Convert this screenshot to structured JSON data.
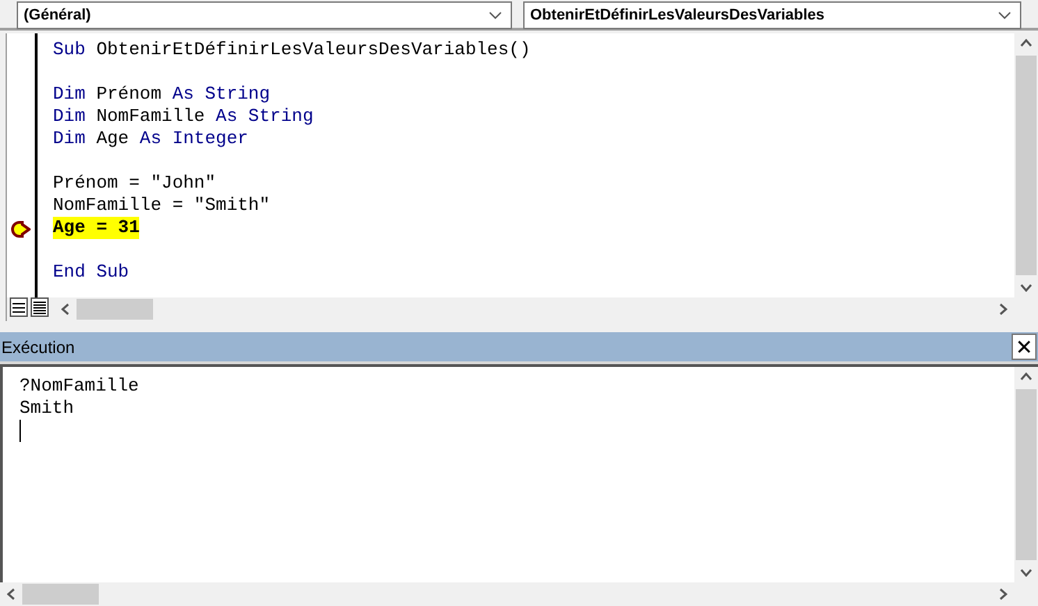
{
  "object_box": {
    "value": "(Général)"
  },
  "procedure_box": {
    "value": "ObtenirEtDéfinirLesValeursDesVariables"
  },
  "code_lines": [
    {
      "gap_before": false,
      "current": false,
      "tokens": [
        {
          "text": "Sub",
          "kind": "keyword"
        },
        {
          "text": " ObtenirEtDéfinirLesValeursDesVariables()",
          "kind": "plain"
        }
      ]
    },
    {
      "gap_before": true,
      "current": false,
      "tokens": [
        {
          "text": "Dim",
          "kind": "keyword"
        },
        {
          "text": " Prénom ",
          "kind": "plain"
        },
        {
          "text": "As String",
          "kind": "keyword"
        }
      ]
    },
    {
      "gap_before": false,
      "current": false,
      "tokens": [
        {
          "text": "Dim",
          "kind": "keyword"
        },
        {
          "text": " NomFamille ",
          "kind": "plain"
        },
        {
          "text": "As String",
          "kind": "keyword"
        }
      ]
    },
    {
      "gap_before": false,
      "current": false,
      "tokens": [
        {
          "text": "Dim",
          "kind": "keyword"
        },
        {
          "text": " Age ",
          "kind": "plain"
        },
        {
          "text": "As Integer",
          "kind": "keyword"
        }
      ]
    },
    {
      "gap_before": true,
      "current": false,
      "tokens": [
        {
          "text": "Prénom = \"John\"",
          "kind": "plain"
        }
      ]
    },
    {
      "gap_before": false,
      "current": false,
      "tokens": [
        {
          "text": "NomFamille = \"Smith\"",
          "kind": "plain"
        }
      ]
    },
    {
      "gap_before": false,
      "current": true,
      "tokens": [
        {
          "text": "Age = 31",
          "kind": "plain"
        }
      ]
    },
    {
      "gap_before": true,
      "current": false,
      "tokens": [
        {
          "text": "End Sub",
          "kind": "keyword"
        }
      ]
    }
  ],
  "immediate": {
    "title": "Exécution",
    "close": "✕",
    "lines": [
      "?NomFamille",
      "Smith"
    ]
  }
}
